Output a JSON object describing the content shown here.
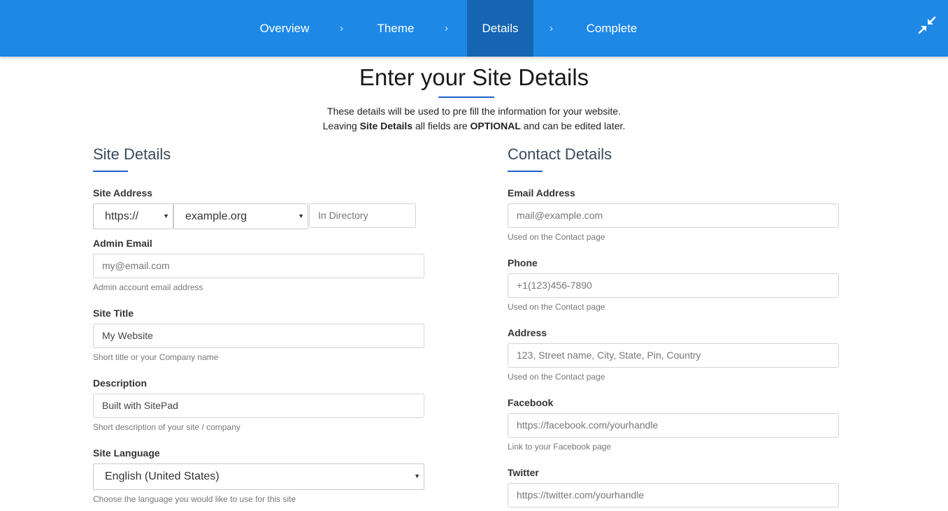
{
  "nav": {
    "items": [
      {
        "label": "Overview"
      },
      {
        "label": "Theme"
      },
      {
        "label": "Details"
      },
      {
        "label": "Complete"
      }
    ],
    "separator": "›",
    "active_index": 2,
    "collapse_icon": "collapse-arrows-icon"
  },
  "header": {
    "title": "Enter your Site Details",
    "intro_line1": "These details will be used to pre fill the information for your website.",
    "intro_line2_a": "Leaving ",
    "intro_line2_b": "Site Details",
    "intro_line2_c": " all fields are ",
    "intro_line2_d": "OPTIONAL",
    "intro_line2_e": " and can be edited later."
  },
  "site_details": {
    "title": "Site Details",
    "site_address": {
      "label": "Site Address",
      "protocol": "https://",
      "domain": "example.org",
      "directory_placeholder": "In Directory"
    },
    "admin_email": {
      "label": "Admin Email",
      "placeholder": "my@email.com",
      "help": "Admin account email address"
    },
    "site_title": {
      "label": "Site Title",
      "value": "My Website",
      "help": "Short title or your Company name"
    },
    "description": {
      "label": "Description",
      "value": "Built with SitePad",
      "help": "Short description of your site / company"
    },
    "site_language": {
      "label": "Site Language",
      "value": "English (United States)",
      "help": "Choose the language you would like to use for this site"
    }
  },
  "contact_details": {
    "title": "Contact Details",
    "email": {
      "label": "Email Address",
      "placeholder": "mail@example.com",
      "help": "Used on the Contact page"
    },
    "phone": {
      "label": "Phone",
      "placeholder": "+1(123)456-7890",
      "help": "Used on the Contact page"
    },
    "address": {
      "label": "Address",
      "placeholder": "123, Street name, City, State, Pin, Country",
      "help": "Used on the Contact page"
    },
    "facebook": {
      "label": "Facebook",
      "placeholder": "https://facebook.com/yourhandle",
      "help": "Link to your Facebook page"
    },
    "twitter": {
      "label": "Twitter",
      "placeholder": "https://twitter.com/yourhandle"
    }
  },
  "colors": {
    "topbar": "#1e88e5",
    "active_tab": "#1565b3",
    "accent_underline": "#1e5fc8"
  }
}
